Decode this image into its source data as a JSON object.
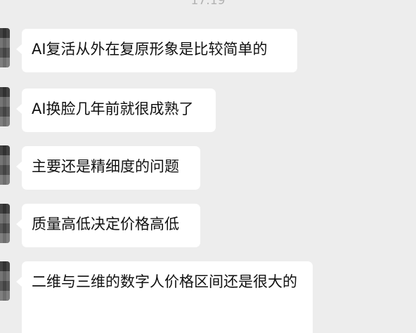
{
  "status": {
    "time": "17:19"
  },
  "messages": [
    {
      "text": "AI复活从外在复原形象是比较简单的"
    },
    {
      "text": "AI换脸几年前就很成熟了"
    },
    {
      "text": "主要还是精细度的问题"
    },
    {
      "text": "质量高低决定价格高低"
    },
    {
      "text": "二维与三维的数字人价格区间还是很大的"
    }
  ]
}
